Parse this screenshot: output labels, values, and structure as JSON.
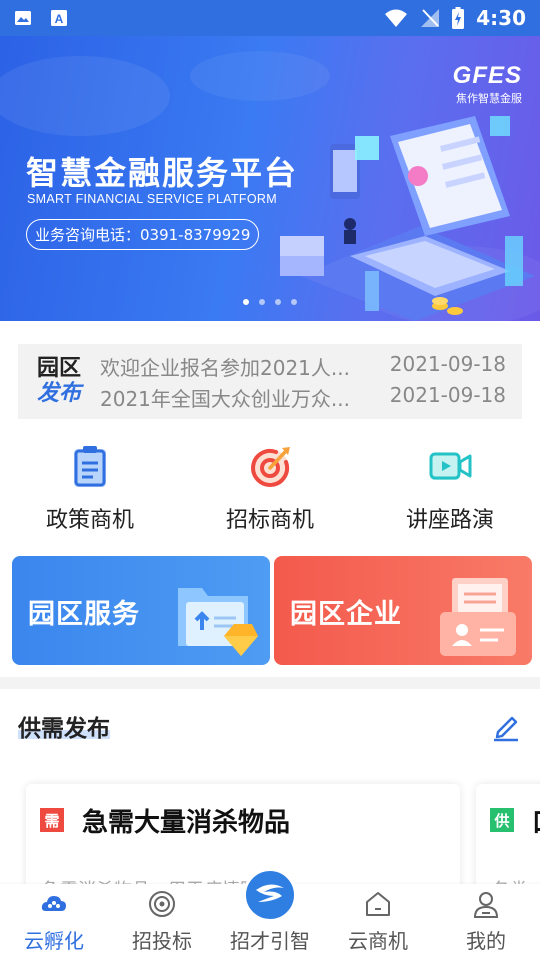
{
  "status_bar": {
    "time": "4:30"
  },
  "banner": {
    "logo_text": "GFES",
    "logo_sub": "焦作智慧金服",
    "title": "智慧金融服务平台",
    "subtitle": "SMART FINANCIAL SERVICE PLATFORM",
    "phone": "业务咨询电话：0391-8379929",
    "carousel_index": 1,
    "carousel_count": 4
  },
  "notice": {
    "badge_line1": "园区",
    "badge_line2": "发布",
    "items": [
      {
        "title": "欢迎企业报名参加2021人...",
        "date": "2021-09-18"
      },
      {
        "title": "2021年全国大众创业万众...",
        "date": "2021-09-18"
      }
    ]
  },
  "quick_entries": [
    {
      "label": "政策商机",
      "icon": "clipboard-icon"
    },
    {
      "label": "招标商机",
      "icon": "target-icon"
    },
    {
      "label": "讲座路演",
      "icon": "video-icon"
    }
  ],
  "big_cards": [
    {
      "label": "园区服务",
      "color": "#3a86ee"
    },
    {
      "label": "园区企业",
      "color": "#f35a4c"
    }
  ],
  "supply_demand": {
    "title": "供需发布",
    "cards": [
      {
        "tag": "需",
        "tag_color": "#ef4a3f",
        "title": "急需大量消杀物品",
        "desc": "急需消杀物品，用于疫情防控"
      },
      {
        "tag": "供",
        "tag_color": "#27c06e",
        "title": "口",
        "desc": "各类"
      }
    ]
  },
  "bottom_nav": [
    {
      "label": "云孵化",
      "icon": "cloud-icon",
      "active": true
    },
    {
      "label": "招投标",
      "icon": "target-icon",
      "active": false
    },
    {
      "label": "招才引智",
      "icon": "talent-logo-icon",
      "active": false
    },
    {
      "label": "云商机",
      "icon": "home-icon",
      "active": false
    },
    {
      "label": "我的",
      "icon": "user-icon",
      "active": false
    }
  ],
  "colors": {
    "primary": "#2f6fe0",
    "red": "#ef4a3f",
    "green": "#27c06e"
  }
}
